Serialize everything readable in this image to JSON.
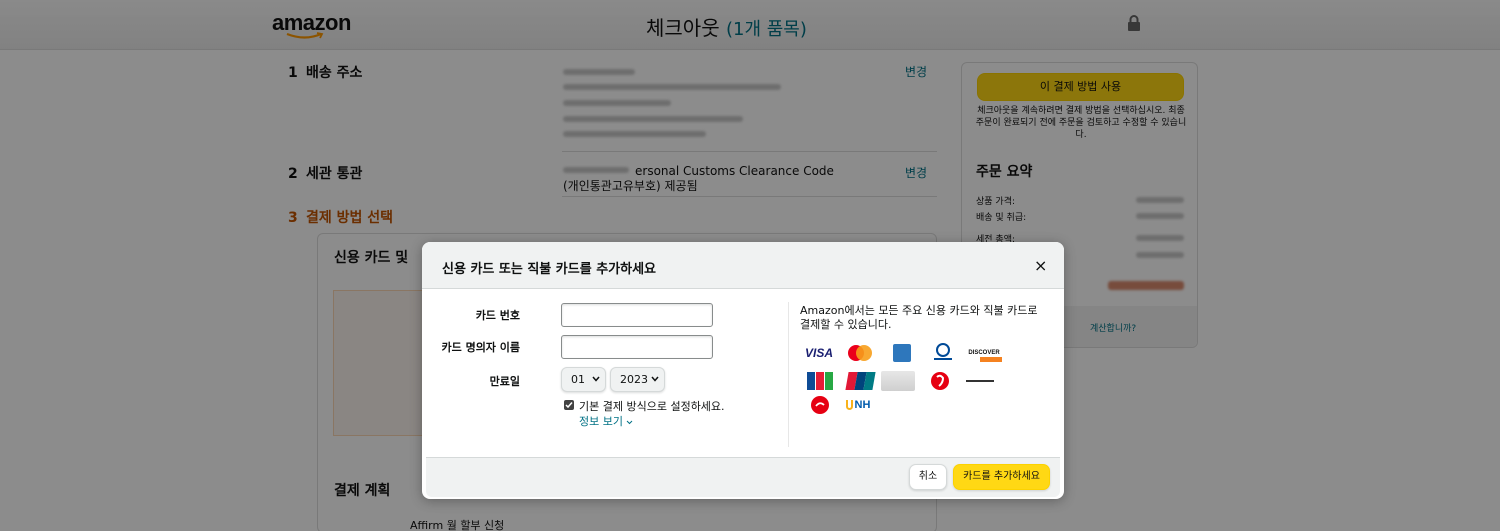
{
  "header": {
    "logo": "amazon",
    "title": "체크아웃",
    "count": "(1개 품목)"
  },
  "sections": [
    {
      "num": "1",
      "title": "배송 주소",
      "change": "변경"
    },
    {
      "num": "2",
      "title": "세관 통관",
      "change": "변경"
    },
    {
      "num": "3",
      "title": "결제 방법 선택"
    }
  ],
  "customs": {
    "line1": "ersonal Customs Clearance Code",
    "line2": "(개인통관고유부호) 제공됨"
  },
  "payment": {
    "subtitle": "신용 카드 및",
    "plan_title": "결제 계획",
    "affirm": "Affirm 월 할부 신청"
  },
  "sidebar": {
    "use_button": "이 결제 방법 사용",
    "note": "체크아웃을 계속하려면 결제 방법을 선택하십시오. 최종 주문이 완료되기 전에 주문을 검토하고 수정할 수 있습니다.",
    "summary_title": "주문 요약",
    "items_label": "상품 가격:",
    "shipping_label": "배송 및 취급:",
    "tax_label": "세전 총액:",
    "footer_link": "계산합니까?"
  },
  "modal": {
    "title": "신용 카드 또는 직불 카드를 추가하세요",
    "close": "×",
    "card_number_label": "카드 번호",
    "card_number_value": "",
    "holder_label": "카드 명의자 이름",
    "holder_value": "",
    "expiry_label": "만료일",
    "month": "01",
    "year": "2023",
    "default_label": "기본 결제 방식으로 설정하세요.",
    "default_checked": true,
    "info_link": "정보 보기",
    "accepts_text": "Amazon에서는 모든 주요 신용 카드와 직불 카드로 결제할 수 있습니다.",
    "card_brands": [
      "VISA",
      "Mastercard",
      "American Express",
      "Diners Club",
      "DISCOVER",
      "JCB",
      "UnionPay",
      "Generic card",
      "Lotte",
      "Shinhan",
      "Hyundai",
      "NH"
    ],
    "cancel": "취소",
    "add": "카드를 추가하세요"
  }
}
